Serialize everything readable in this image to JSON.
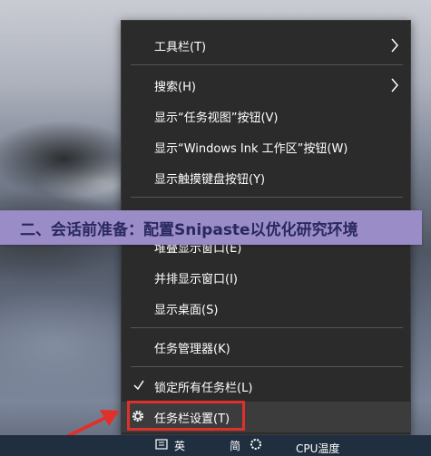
{
  "menu": {
    "items": [
      {
        "label": "工具栏(T)"
      },
      {
        "label": "搜索(H)"
      },
      {
        "label": "显示“任务视图”按钮(V)"
      },
      {
        "label": "显示“Windows Ink 工作区”按钮(W)"
      },
      {
        "label": "显示触摸键盘按钮(Y)"
      },
      {
        "label": "堆叠显示窗口(E)"
      },
      {
        "label": "并排显示窗口(I)"
      },
      {
        "label": "显示桌面(S)"
      },
      {
        "label": "任务管理器(K)"
      },
      {
        "label": "锁定所有任务栏(L)"
      },
      {
        "label": "任务栏设置(T)"
      }
    ]
  },
  "banner": {
    "text": "二、会话前准备：配置Snipaste以优化研究环境"
  },
  "taskbar": {
    "text_left": "英",
    "text_mid": "简",
    "cpu_label": "CPU温度"
  },
  "colors": {
    "menu_bg": "#2b2b2b",
    "highlight": "#e0302b",
    "banner_bg": "#9a8cc6",
    "taskbar_bg": "#1f2f3f"
  },
  "icons": [
    "chevron-right-icon",
    "checkmark-icon",
    "gear-icon",
    "red-arrow-icon",
    "ime-icon",
    "settings-icon"
  ]
}
